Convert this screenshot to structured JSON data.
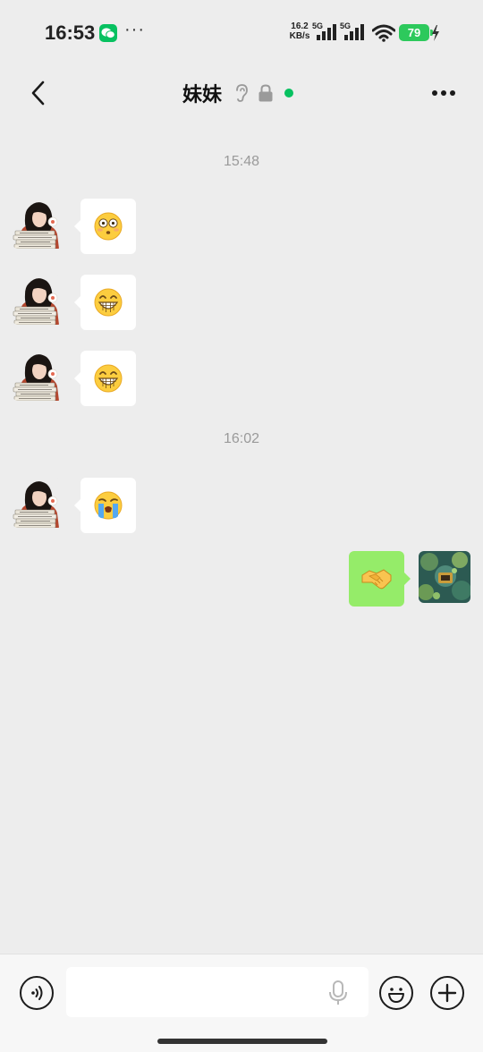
{
  "status_bar": {
    "time": "16:53",
    "more_dots": "···",
    "net_speed_value": "16.2",
    "net_speed_unit": "KB/s",
    "sim1_tag": "5G",
    "sim2_tag": "5G",
    "battery_level": "79",
    "icons": [
      "wechat-icon",
      "signal-icon",
      "wifi-icon",
      "battery-icon",
      "charging-bolt-icon"
    ]
  },
  "nav": {
    "title": "妹妹",
    "icons": [
      "back-icon",
      "ear-icon",
      "lock-icon",
      "online-dot",
      "more-icon"
    ]
  },
  "chat": {
    "groups": [
      {
        "timestamp": "15:48",
        "messages": [
          {
            "direction": "in",
            "sender": "妹妹",
            "emoji": "😳"
          },
          {
            "direction": "in",
            "sender": "妹妹",
            "emoji": "😁"
          },
          {
            "direction": "in",
            "sender": "妹妹",
            "emoji": "😁"
          }
        ]
      },
      {
        "timestamp": "16:02",
        "messages": [
          {
            "direction": "in",
            "sender": "妹妹",
            "emoji": "😭"
          },
          {
            "direction": "out",
            "sender": "me",
            "emoji": "🤝"
          }
        ]
      }
    ]
  },
  "input_bar": {
    "icons": [
      "voice-mode-icon",
      "mic-icon",
      "emoji-icon",
      "plus-icon"
    ]
  },
  "colors": {
    "background": "#ededed",
    "incoming_bubble": "#ffffff",
    "outgoing_bubble": "#95ec69",
    "accent_green": "#07c160",
    "battery_green": "#2dc95c",
    "timestamp_text": "#9a9a9a"
  }
}
